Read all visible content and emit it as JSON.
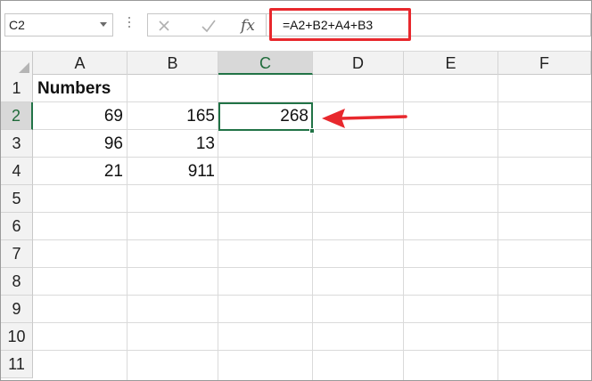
{
  "formula_bar": {
    "name_box": "C2",
    "formula": "=A2+B2+A4+B3",
    "icons": [
      "cancel-icon",
      "enter-check-icon",
      "insert-function-icon"
    ]
  },
  "columns": [
    "A",
    "B",
    "C",
    "D",
    "E",
    "F"
  ],
  "rows": [
    "1",
    "2",
    "3",
    "4",
    "5",
    "6",
    "7",
    "8",
    "9",
    "10",
    "11"
  ],
  "selected_cell": {
    "column": "C",
    "row": "2"
  },
  "cells": {
    "A1": "Numbers",
    "A2": "69",
    "B2": "165",
    "C2": "268",
    "A3": "96",
    "B3": "13",
    "A4": "21",
    "B4": "911"
  },
  "colors": {
    "highlight": "#e8282d",
    "selection": "#217346",
    "arrow": "#e8282d"
  }
}
